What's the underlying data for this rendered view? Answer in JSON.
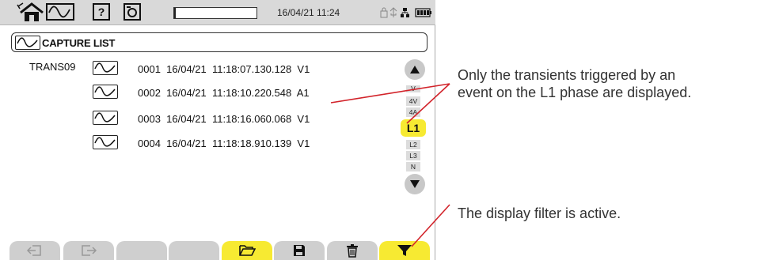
{
  "status_bar": {
    "datetime": "16/04/21 11:24",
    "progress_fraction": 0.02,
    "icons": [
      "home-icon",
      "waveform-icon",
      "help-icon",
      "camera-icon",
      "lock-icon",
      "usb-icon",
      "network-icon",
      "battery-icon"
    ]
  },
  "header": {
    "title": "CAPTURE LIST"
  },
  "list": {
    "folder": "TRANS09",
    "rows": [
      {
        "text": "0001  16/04/21  11:18:07.130.128  V1"
      },
      {
        "text": "0002  16/04/21  11:18:10.220.548  A1"
      },
      {
        "text": "0003  16/04/21  11:18:16.060.068  V1"
      },
      {
        "text": "0004  16/04/21  11:18:18.910.139  V1"
      }
    ]
  },
  "filter": {
    "items_above": [
      "V",
      "4V",
      "4A"
    ],
    "active": "L1",
    "items_below": [
      "L2",
      "L3",
      "N"
    ]
  },
  "bottom_tabs": [
    {
      "icon": "exit-left-icon",
      "active": false
    },
    {
      "icon": "exit-right-icon",
      "active": false
    },
    {
      "icon": "",
      "active": false
    },
    {
      "icon": "",
      "active": false
    },
    {
      "icon": "open-folder-icon",
      "active": true
    },
    {
      "icon": "save-icon",
      "active": false
    },
    {
      "icon": "trash-icon",
      "active": false
    },
    {
      "icon": "filter-icon",
      "active": true
    }
  ],
  "annotations": {
    "filter_note_line1": "Only the transients triggered by an",
    "filter_note_line2": "event on the L1 phase are displayed.",
    "active_note": "The display filter is active."
  },
  "colors": {
    "accent_yellow": "#f7ea32",
    "callout_red": "#d2232a",
    "tab_gray": "#cfcfcf"
  }
}
